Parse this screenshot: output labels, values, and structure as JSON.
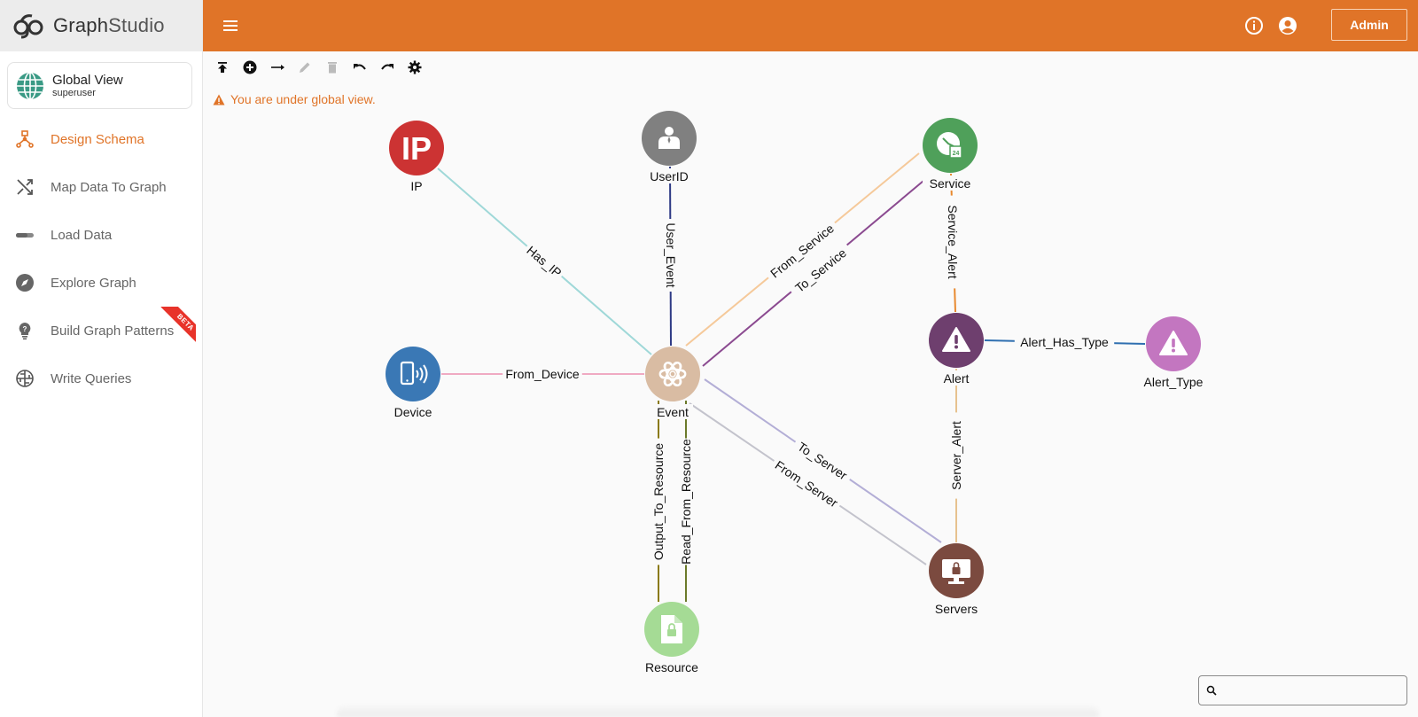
{
  "app": {
    "logo_bold": "Graph",
    "logo_light": "Studio"
  },
  "view_card": {
    "title": "Global View",
    "subtitle": "superuser"
  },
  "sidebar": {
    "items": [
      {
        "label": "Design Schema",
        "icon": "schema-icon",
        "active": true
      },
      {
        "label": "Map Data To Graph",
        "icon": "shuffle-icon",
        "active": false
      },
      {
        "label": "Load Data",
        "icon": "progress-bar-icon",
        "active": false
      },
      {
        "label": "Explore Graph",
        "icon": "compass-icon",
        "active": false
      },
      {
        "label": "Build Graph Patterns",
        "icon": "lightbulb-icon",
        "active": false,
        "badge": "BETA"
      },
      {
        "label": "Write Queries",
        "icon": "globe-grid-icon",
        "active": false
      }
    ]
  },
  "header": {
    "admin_label": "Admin",
    "accent_color": "#e07428"
  },
  "toolbar": {
    "buttons": [
      "publish-icon",
      "add-vertex-icon",
      "add-edge-icon",
      "edit-icon",
      "delete-icon",
      "undo-icon",
      "redo-icon",
      "settings-icon"
    ]
  },
  "warning": {
    "text": "You are under global view."
  },
  "search": {
    "value": "",
    "placeholder": ""
  },
  "graph": {
    "vertices": [
      {
        "id": "IP",
        "label": "IP",
        "color": "#cc3333",
        "icon": "ip-icon"
      },
      {
        "id": "UserID",
        "label": "UserID",
        "color": "#808080",
        "icon": "user-icon"
      },
      {
        "id": "Service",
        "label": "Service",
        "color": "#4fa05a",
        "icon": "clock-24-icon"
      },
      {
        "id": "Device",
        "label": "Device",
        "color": "#3a78b5",
        "icon": "phone-signal-icon"
      },
      {
        "id": "Event",
        "label": "Event",
        "color": "#d9bca3",
        "icon": "atom-icon"
      },
      {
        "id": "Alert",
        "label": "Alert",
        "color": "#6e3f6e",
        "icon": "warning-icon"
      },
      {
        "id": "Alert_Type",
        "label": "Alert_Type",
        "color": "#c376c0",
        "icon": "warning-icon"
      },
      {
        "id": "Resource",
        "label": "Resource",
        "color": "#a5db95",
        "icon": "locked-file-icon"
      },
      {
        "id": "Servers",
        "label": "Servers",
        "color": "#7b4a3f",
        "icon": "locked-monitor-icon"
      }
    ],
    "edges": [
      {
        "label": "Has_IP",
        "from": "IP",
        "to": "Event",
        "color": "#9fd8d8"
      },
      {
        "label": "User_Event",
        "from": "UserID",
        "to": "Event",
        "color": "#2e3a85"
      },
      {
        "label": "From_Service",
        "from": "Service",
        "to": "Event",
        "color": "#f5c99a"
      },
      {
        "label": "To_Service",
        "from": "Event",
        "to": "Service",
        "color": "#8b4a90"
      },
      {
        "label": "Service_Alert",
        "from": "Service",
        "to": "Alert",
        "color": "#e8892e"
      },
      {
        "label": "Alert_Has_Type",
        "from": "Alert",
        "to": "Alert_Type",
        "color": "#2f6fb0"
      },
      {
        "label": "From_Device",
        "from": "Device",
        "to": "Event",
        "color": "#f0aac2"
      },
      {
        "label": "Output_To_Resource",
        "from": "Event",
        "to": "Resource",
        "color": "#8a7a10"
      },
      {
        "label": "Read_From_Resource",
        "from": "Resource",
        "to": "Event",
        "color": "#6b7a2a"
      },
      {
        "label": "To_Server",
        "from": "Event",
        "to": "Servers",
        "color": "#b3aed6"
      },
      {
        "label": "From_Server",
        "from": "Servers",
        "to": "Event",
        "color": "#c3c3cc"
      },
      {
        "label": "Server_Alert",
        "from": "Servers",
        "to": "Alert",
        "color": "#e7c28f"
      }
    ]
  }
}
